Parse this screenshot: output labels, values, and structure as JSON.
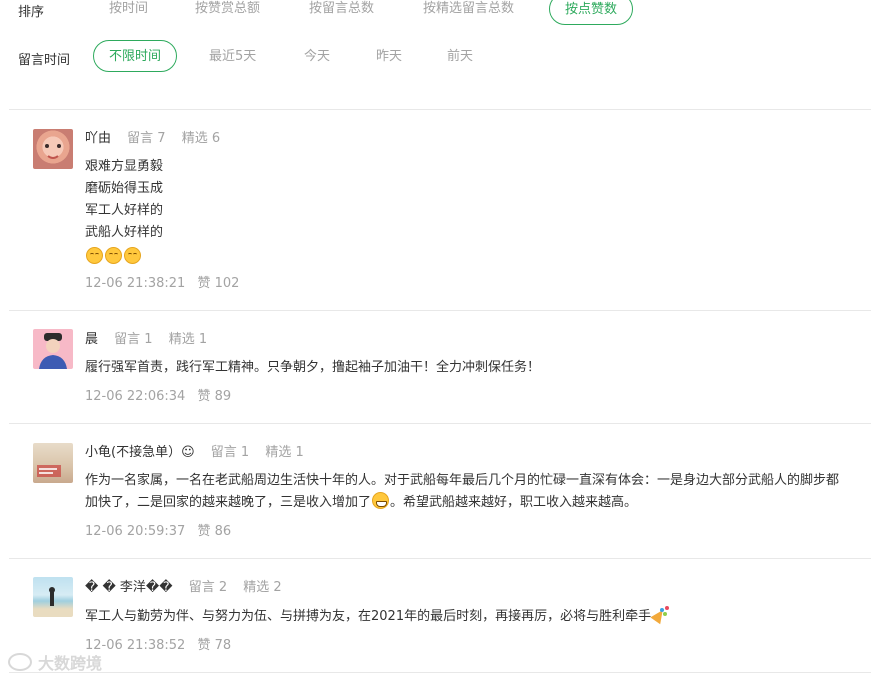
{
  "sort": {
    "label": "排序",
    "options": [
      "按时间",
      "按赞赏总额",
      "按留言总数",
      "按精选留言总数",
      "按点赞数"
    ],
    "active": "按点赞数"
  },
  "time_filter": {
    "label": "留言时间",
    "options": [
      "不限时间",
      "最近5天",
      "今天",
      "昨天",
      "前天"
    ],
    "active": "不限时间"
  },
  "comments": [
    {
      "nick": "吖由",
      "liuyan": "留言 7",
      "jingxuan": "精选 6",
      "lines": [
        "艰难方显勇毅",
        "磨砺始得玉成",
        "军工人好样的",
        "武船人好样的"
      ],
      "emoji": "kiss-face-icon",
      "time": "12-06 21:38:21",
      "likes": "赞 102"
    },
    {
      "nick": "晨",
      "liuyan": "留言 1",
      "jingxuan": "精选 1",
      "text": "履行强军首责，践行军工精神。只争朝夕，撸起袖子加油干！全力冲刺保任务！",
      "time": "12-06 22:06:34",
      "likes": "赞 89"
    },
    {
      "nick": "小龟(不接急单）☺",
      "liuyan": "留言 1",
      "jingxuan": "精选 1",
      "text_a": "作为一名家属，一名在老武船周边生活快十年的人。对于武船每年最后几个月的忙碌一直深有体会：一是身边大部分武船人的脚步都加快了，二是回家的越来越晚了，三是收入增加了",
      "text_b": "。希望武船越来越好，职工收入越来越高。",
      "emoji": "grin-face-icon",
      "time": "12-06 20:59:37",
      "likes": "赞 86"
    },
    {
      "nick": "� � 李洋��",
      "liuyan": "留言 2",
      "jingxuan": "精选 2",
      "text": "军工人与勤劳为伴、与努力为伍、与拼搏为友，在2021年的最后时刻，再接再厉，必将与胜利牵手",
      "emoji": "party-popper-icon",
      "time": "12-06 21:38:52",
      "likes": "赞 78"
    }
  ],
  "watermark": "大数跨境",
  "colors": {
    "accent": "#2eaa5d",
    "muted": "#a3a3a3",
    "text": "#333333"
  }
}
